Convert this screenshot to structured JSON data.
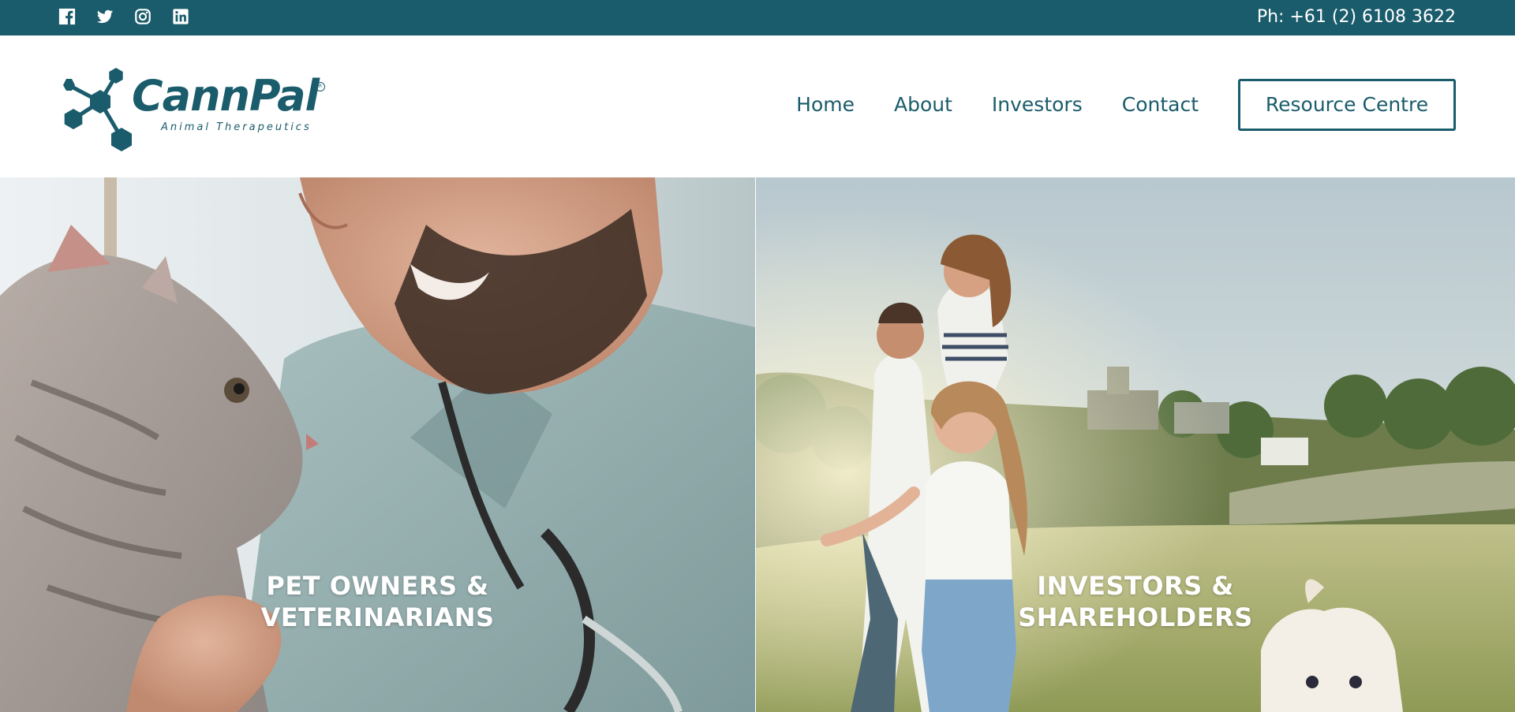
{
  "topbar": {
    "social": [
      "facebook-icon",
      "twitter-icon",
      "instagram-icon",
      "linkedin-icon"
    ],
    "phone": "Ph: +61 (2) 6108 3622"
  },
  "brand": {
    "name": "CannPal",
    "tagline": "Animal Therapeutics",
    "color": "#1a5c6b"
  },
  "nav": {
    "items": [
      "Home",
      "About",
      "Investors",
      "Contact"
    ],
    "cta": "Resource Centre"
  },
  "panels": [
    {
      "line1": "PET OWNERS &",
      "line2": "VETERINARIANS"
    },
    {
      "line1": "INVESTORS &",
      "line2": "SHAREHOLDERS"
    }
  ]
}
